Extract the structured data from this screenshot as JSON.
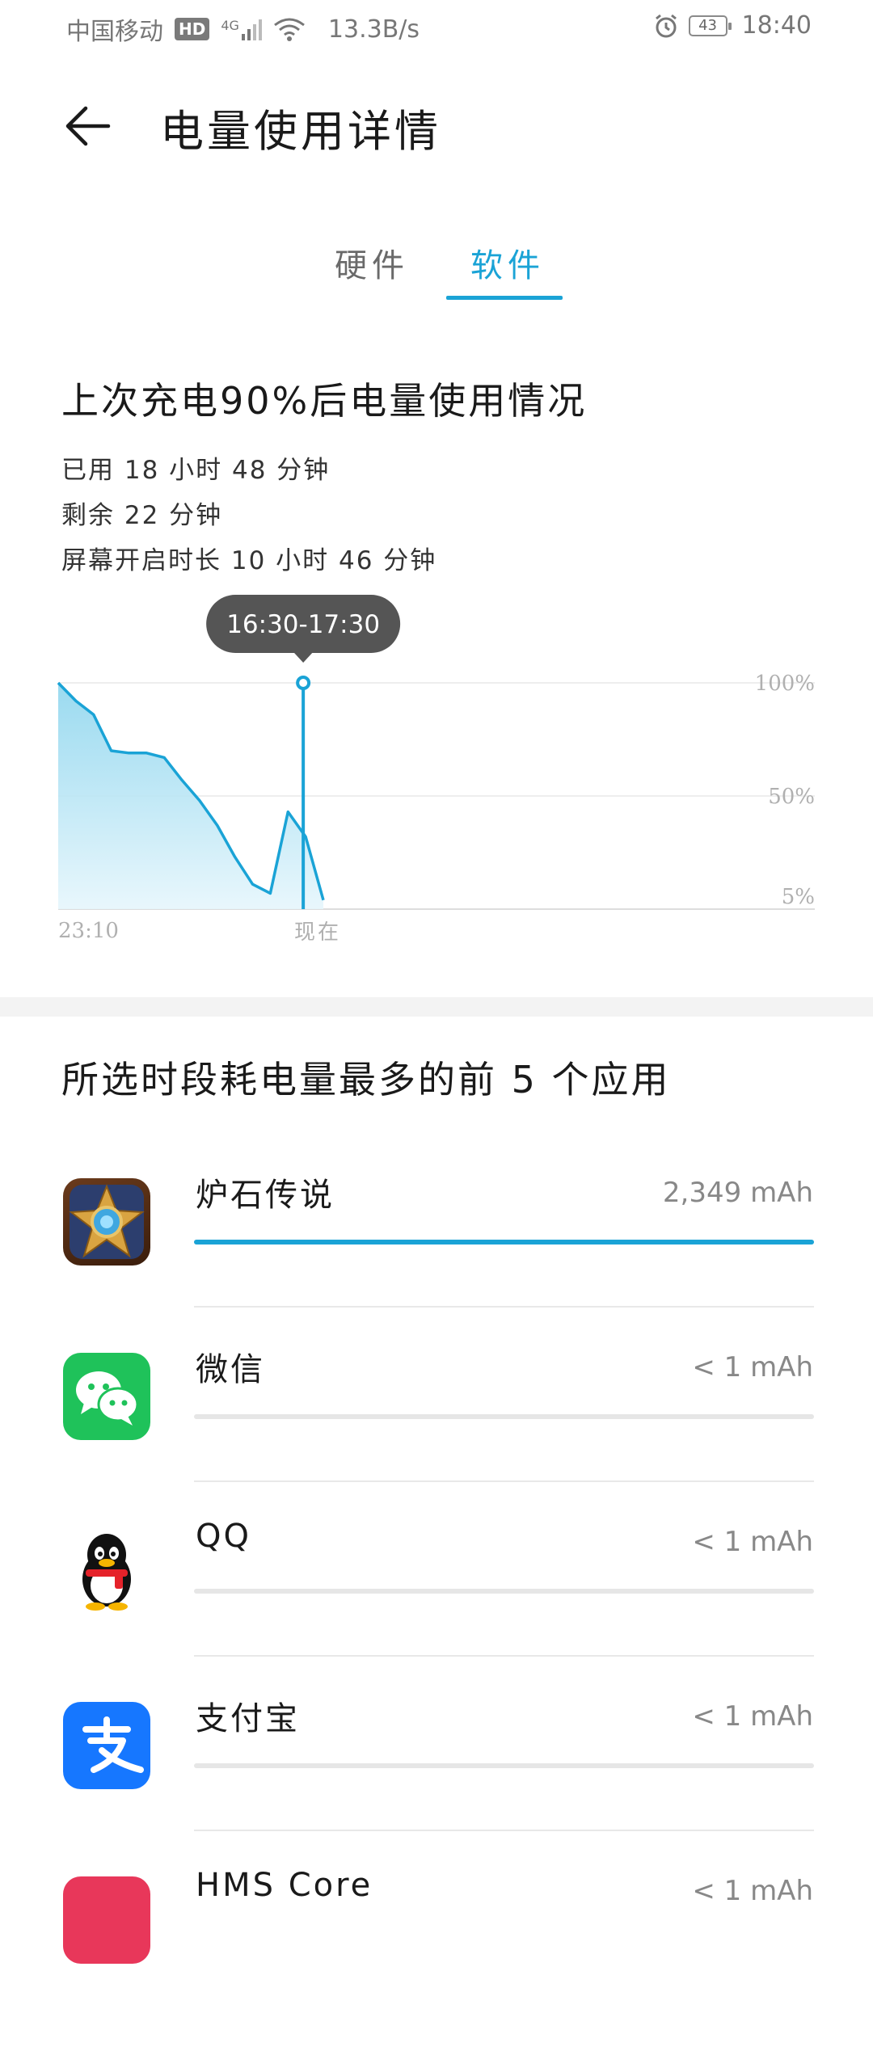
{
  "status_bar": {
    "carrier": "中国移动",
    "hd": "HD",
    "network": "4G",
    "speed": "13.3B/s",
    "battery_level": "43",
    "time": "18:40"
  },
  "header": {
    "title": "电量使用详情"
  },
  "tabs": [
    {
      "label": "硬件",
      "selected": false
    },
    {
      "label": "软件",
      "selected": true
    }
  ],
  "summary": {
    "title": "上次充电90%后电量使用情况",
    "used": "已用 18 小时 48 分钟",
    "remaining": "剩余 22 分钟",
    "screen_on": "屏幕开启时长 10 小时 46 分钟"
  },
  "chart_data": {
    "type": "area",
    "y_tick_labels": [
      "100%",
      "50%",
      "5%"
    ],
    "x_tick_labels": [
      "23:10",
      "现在"
    ],
    "tooltip": "16:30-17:30",
    "series": [
      {
        "values": [
          100,
          92,
          86,
          70,
          69,
          69,
          67,
          57,
          48,
          37,
          23,
          11,
          7,
          43,
          32,
          4
        ]
      }
    ],
    "selected_index": 14,
    "colors": {
      "line": "#1aa3d6",
      "fill": "#a8e0f2",
      "tooltip_bg": "#555555"
    }
  },
  "top_apps": {
    "title": "所选时段耗电量最多的前 5 个应用",
    "items": [
      {
        "name": "炉石传说",
        "value": "2,349 mAh",
        "fraction": 1.0,
        "icon": "hearthstone-icon"
      },
      {
        "name": "微信",
        "value": "< 1 mAh",
        "fraction": 0.0,
        "icon": "wechat-icon"
      },
      {
        "name": "QQ",
        "value": "< 1 mAh",
        "fraction": 0.0,
        "icon": "qq-penguin-icon"
      },
      {
        "name": "支付宝",
        "value": "< 1 mAh",
        "fraction": 0.0,
        "icon": "alipay-icon"
      },
      {
        "name": "HMS Core",
        "value": "< 1 mAh",
        "fraction": 0.0,
        "icon": "hms-core-icon"
      }
    ]
  }
}
